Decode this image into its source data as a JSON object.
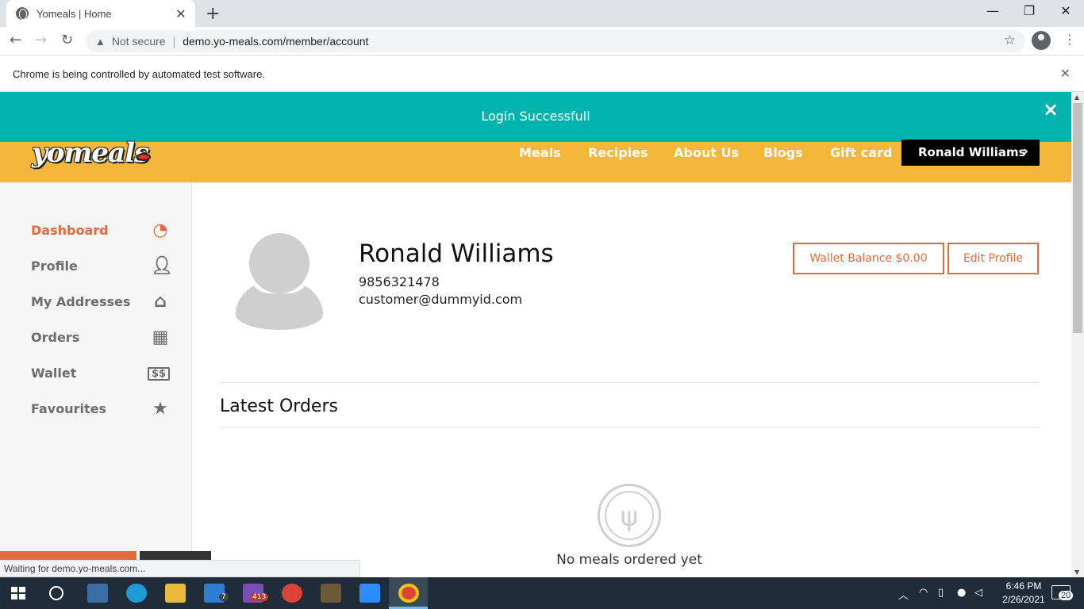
{
  "browser": {
    "tab_title": "Yomeals | Home",
    "tab_close": "✕",
    "new_tab": "+",
    "security_label": "Not secure",
    "url": "demo.yo-meals.com/member/account",
    "infobar_text": "Chrome is being controlled by automated test software.",
    "status_text": "Waiting for demo.yo-meals.com..."
  },
  "site": {
    "alert_text": "Login Successfull",
    "logo_text": "yomeals",
    "nav": [
      "Meals",
      "Recipies",
      "About Us",
      "Blogs",
      "Gift card"
    ],
    "user_button": "Ronald Williams",
    "sidebar": [
      {
        "label": "Dashboard",
        "icon": "speedometer-icon",
        "active": true
      },
      {
        "label": "Profile",
        "icon": "person-icon",
        "active": false
      },
      {
        "label": "My Addresses",
        "icon": "home-icon",
        "active": false
      },
      {
        "label": "Orders",
        "icon": "calendar-icon",
        "active": false
      },
      {
        "label": "Wallet",
        "icon": "money-icon",
        "active": false
      },
      {
        "label": "Favourites",
        "icon": "star-icon",
        "active": false
      }
    ],
    "profile": {
      "name": "Ronald Williams",
      "phone": "9856321478",
      "email": "customer@dummyid.com"
    },
    "wallet_button": "Wallet Balance $0.00",
    "edit_button": "Edit Profile",
    "latest_orders_title": "Latest Orders",
    "empty_text": "No meals ordered yet",
    "accent_color": "#e26a3c",
    "header_color": "#f4b73a",
    "alert_color": "#00b3ad"
  },
  "taskbar": {
    "time": "6:46 PM",
    "date": "2/26/2021",
    "notification_count": "20",
    "badges": {
      "mail": "7",
      "viber": "413"
    }
  }
}
